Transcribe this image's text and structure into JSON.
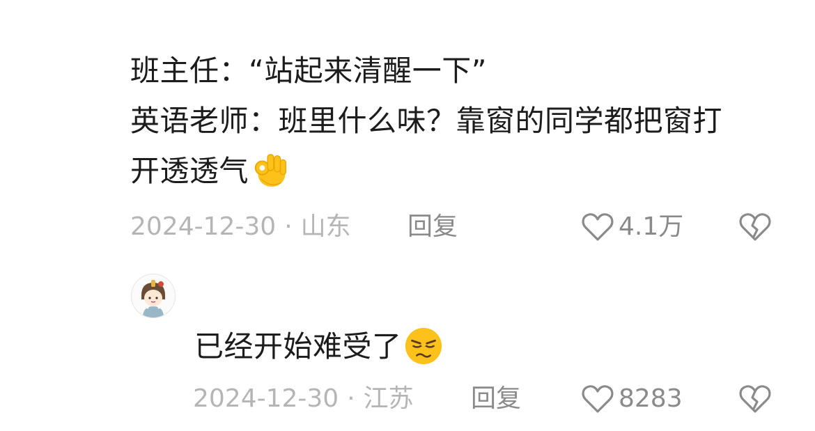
{
  "comments": [
    {
      "lines": [
        "班主任：“站起来清醒一下”",
        "英语老师：班里什么味？靠窗的同学都把窗打",
        "开透透气"
      ],
      "emoji": "ok-hand-emoji",
      "date": "2024-12-30",
      "location": "山东",
      "reply_label": "回复",
      "like_count": "4.1万"
    },
    {
      "lines": [
        "已经开始难受了"
      ],
      "emoji": "unamused-face-emoji",
      "date": "2024-12-30",
      "location": "江苏",
      "reply_label": "回复",
      "like_count": "8283"
    }
  ],
  "meta_separator": "·",
  "icons": {
    "like": "heart-outline-icon",
    "dislike": "broken-heart-icon"
  },
  "colors": {
    "text": "#1c1c1c",
    "meta": "#b5b5b5",
    "action": "#8a8a8a",
    "emoji_yellow": "#fcc21b"
  }
}
